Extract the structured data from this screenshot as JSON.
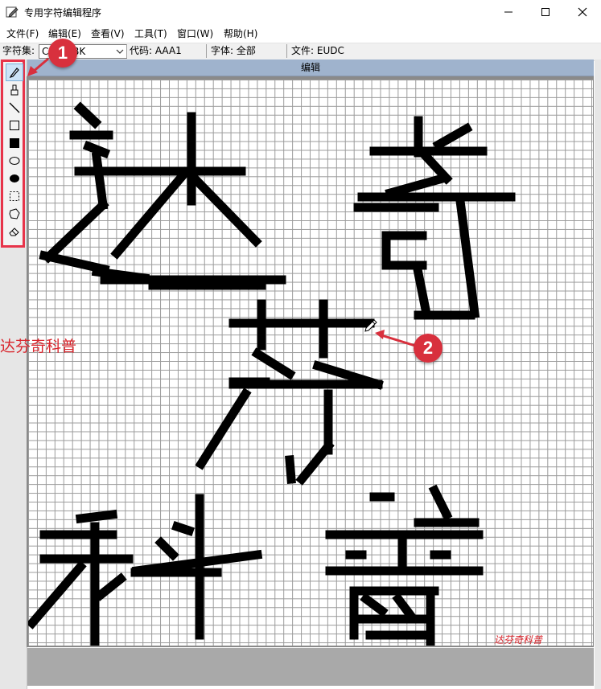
{
  "window": {
    "title": "专用字符编辑程序",
    "app_icon": "pen-on-paper-icon",
    "controls": [
      "minimize-icon",
      "maximize-icon",
      "close-icon"
    ]
  },
  "menu": {
    "file": "文件(F)",
    "edit": "编辑(E)",
    "view": "查看(V)",
    "tools": "工具(T)",
    "window": "窗口(W)",
    "help": "帮助(H)"
  },
  "statusbar": {
    "charset_label": "字符集:",
    "charset_value": "CHS GBK",
    "code": "代码: AAA1",
    "font": "字体: 全部",
    "file": "文件: EUDC"
  },
  "editor": {
    "header": "编辑"
  },
  "tools": [
    "pencil-icon",
    "brush-icon",
    "line-icon",
    "hollow-rectangle-icon",
    "filled-rectangle-icon",
    "hollow-ellipse-icon",
    "filled-ellipse-icon",
    "rect-select-icon",
    "freeform-select-icon",
    "eraser-icon"
  ],
  "annotations": {
    "badge1": "1",
    "badge2": "2",
    "watermark": "达芬奇科普",
    "watermark_small": "达芬奇科普",
    "accent_color": "#d8303d"
  },
  "colors": {
    "highlight_border": "#e7344a",
    "editor_header": "#9fb3cd",
    "pixel": "#000000",
    "bottom_panel": "#a9a9a9"
  }
}
